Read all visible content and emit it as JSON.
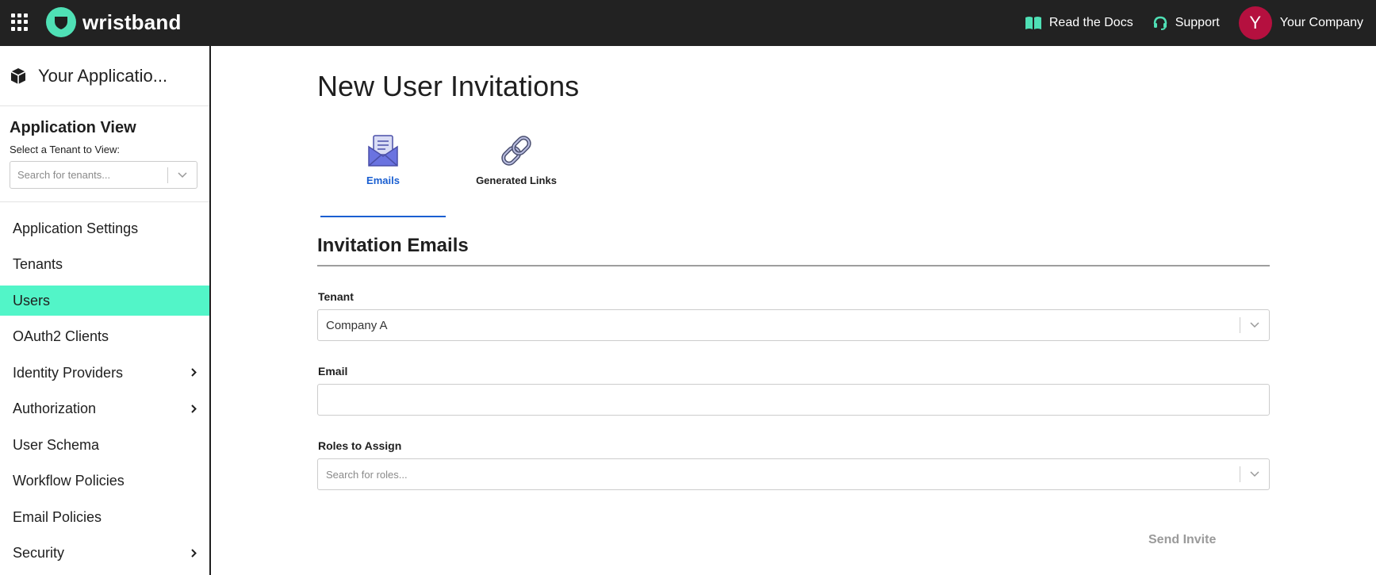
{
  "topbar": {
    "brand": "wristband",
    "links": {
      "docs": "Read the Docs",
      "support": "Support"
    },
    "avatar_initial": "Y",
    "company": "Your Company",
    "colors": {
      "bar": "#222222",
      "brand_accent": "#4fe0b5",
      "avatar": "#b5103f"
    }
  },
  "sidebar": {
    "app_name": "Your Applicatio...",
    "view_title": "Application View",
    "tenant_label": "Select a Tenant to View:",
    "tenant_placeholder": "Search for tenants...",
    "items": [
      {
        "label": "Application Settings",
        "active": false,
        "has_submenu": false
      },
      {
        "label": "Tenants",
        "active": false,
        "has_submenu": false
      },
      {
        "label": "Users",
        "active": true,
        "has_submenu": false
      },
      {
        "label": "OAuth2 Clients",
        "active": false,
        "has_submenu": false
      },
      {
        "label": "Identity Providers",
        "active": false,
        "has_submenu": true
      },
      {
        "label": "Authorization",
        "active": false,
        "has_submenu": true
      },
      {
        "label": "User Schema",
        "active": false,
        "has_submenu": false
      },
      {
        "label": "Workflow Policies",
        "active": false,
        "has_submenu": false
      },
      {
        "label": "Email Policies",
        "active": false,
        "has_submenu": false
      },
      {
        "label": "Security",
        "active": false,
        "has_submenu": true
      }
    ],
    "active_color": "#52f5c8"
  },
  "main": {
    "title": "New User Invitations",
    "tabs": [
      {
        "label": "Emails",
        "icon": "envelope-icon",
        "active": true
      },
      {
        "label": "Generated Links",
        "icon": "link-icon",
        "active": false
      }
    ],
    "section_title": "Invitation Emails",
    "form": {
      "tenant_label": "Tenant",
      "tenant_value": "Company A",
      "email_label": "Email",
      "email_value": "",
      "roles_label": "Roles to Assign",
      "roles_placeholder": "Search for roles..."
    },
    "send_label": "Send Invite",
    "accent_color": "#1a5fd1"
  }
}
